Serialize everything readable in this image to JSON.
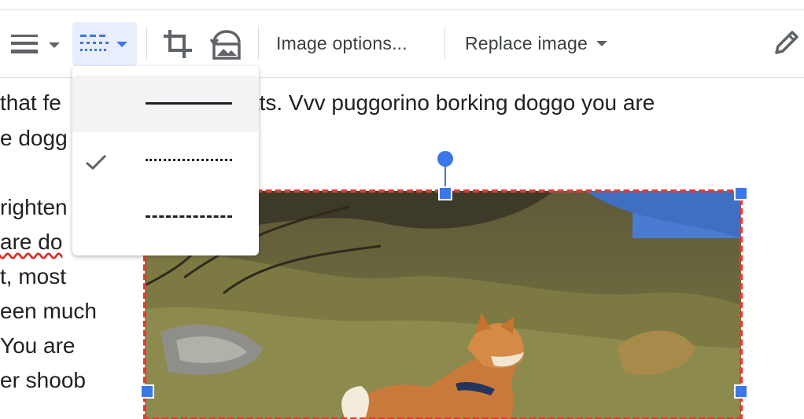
{
  "toolbar": {
    "image_options_label": "Image options...",
    "replace_image_label": "Replace image",
    "icons": [
      "line-weight-icon",
      "line-dash-icon",
      "crop-icon",
      "reset-image-icon",
      "pencil-icon"
    ],
    "accent_color": "#3b78e7"
  },
  "document": {
    "lines": [
      {
        "text": "that fe"
      },
      {
        "text": "ats. Vvv puggorino borking doggo you are"
      },
      {
        "text": "e dogg"
      },
      {
        "text": "righten"
      },
      {
        "text": "are do"
      },
      {
        "text": "t, most"
      },
      {
        "text": "een much"
      },
      {
        "text": "You are"
      },
      {
        "text": "er shoob"
      }
    ]
  },
  "dash_menu": {
    "items": [
      {
        "style": "solid",
        "selected": false
      },
      {
        "style": "dotted",
        "selected": true
      },
      {
        "style": "dashed",
        "selected": false
      }
    ]
  },
  "image": {
    "selection_border_color": "#e53935",
    "handle_color": "#3b78e7"
  }
}
